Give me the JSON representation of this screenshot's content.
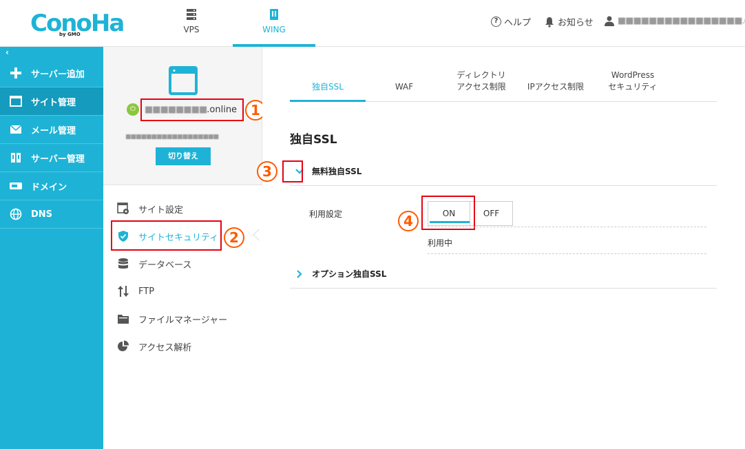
{
  "header": {
    "logo_text": "ConoHa",
    "logo_sub": "by GMO",
    "nav": [
      {
        "label": "VPS",
        "icon": "server-icon"
      },
      {
        "label": "WING",
        "icon": "building-icon"
      }
    ],
    "help_label": "ヘルプ",
    "news_label": "お知らせ",
    "user_label": "■■■■■■■■■■■■■■■■.com"
  },
  "sidebar": {
    "collapse_glyph": "‹",
    "items": [
      {
        "label": "サーバー追加",
        "icon": "plus-icon"
      },
      {
        "label": "サイト管理",
        "icon": "window-icon"
      },
      {
        "label": "メール管理",
        "icon": "mail-icon"
      },
      {
        "label": "サーバー管理",
        "icon": "server-manage-icon"
      },
      {
        "label": "ドメイン",
        "icon": "domain-icon"
      },
      {
        "label": "DNS",
        "icon": "globe-icon"
      }
    ]
  },
  "site": {
    "name_masked": "■■■■■■■■",
    "name_suffix": ".online",
    "sub_masked": "■■■■■■■■■■■■■■■■■■",
    "switch_label": "切り替え"
  },
  "site_menu": [
    {
      "label": "サイト設定",
      "icon": "site-settings-icon"
    },
    {
      "label": "サイトセキュリティ",
      "icon": "shield-icon"
    },
    {
      "label": "データベース",
      "icon": "database-icon"
    },
    {
      "label": "FTP",
      "icon": "transfer-icon"
    },
    {
      "label": "ファイルマネージャー",
      "icon": "folder-icon"
    },
    {
      "label": "アクセス解析",
      "icon": "pie-chart-icon"
    }
  ],
  "tabs": [
    {
      "label": "独自SSL"
    },
    {
      "label": "WAF"
    },
    {
      "label": "ディレクトリ\nアクセス制限"
    },
    {
      "label": "IPアクセス制限"
    },
    {
      "label": "WordPress\nセキュリティ"
    }
  ],
  "section_title": "独自SSL",
  "free_ssl": {
    "title": "無料独自SSL",
    "field_label": "利用設定",
    "on_label": "ON",
    "off_label": "OFF",
    "status": "利用中"
  },
  "option_ssl": {
    "title": "オプション独自SSL"
  },
  "annotations": [
    "1",
    "2",
    "3",
    "4"
  ],
  "colors": {
    "accent": "#1eb3d6",
    "annotation_box": "#e60012",
    "annotation_circle": "#ff5a00",
    "power_on": "#8cc63f"
  }
}
